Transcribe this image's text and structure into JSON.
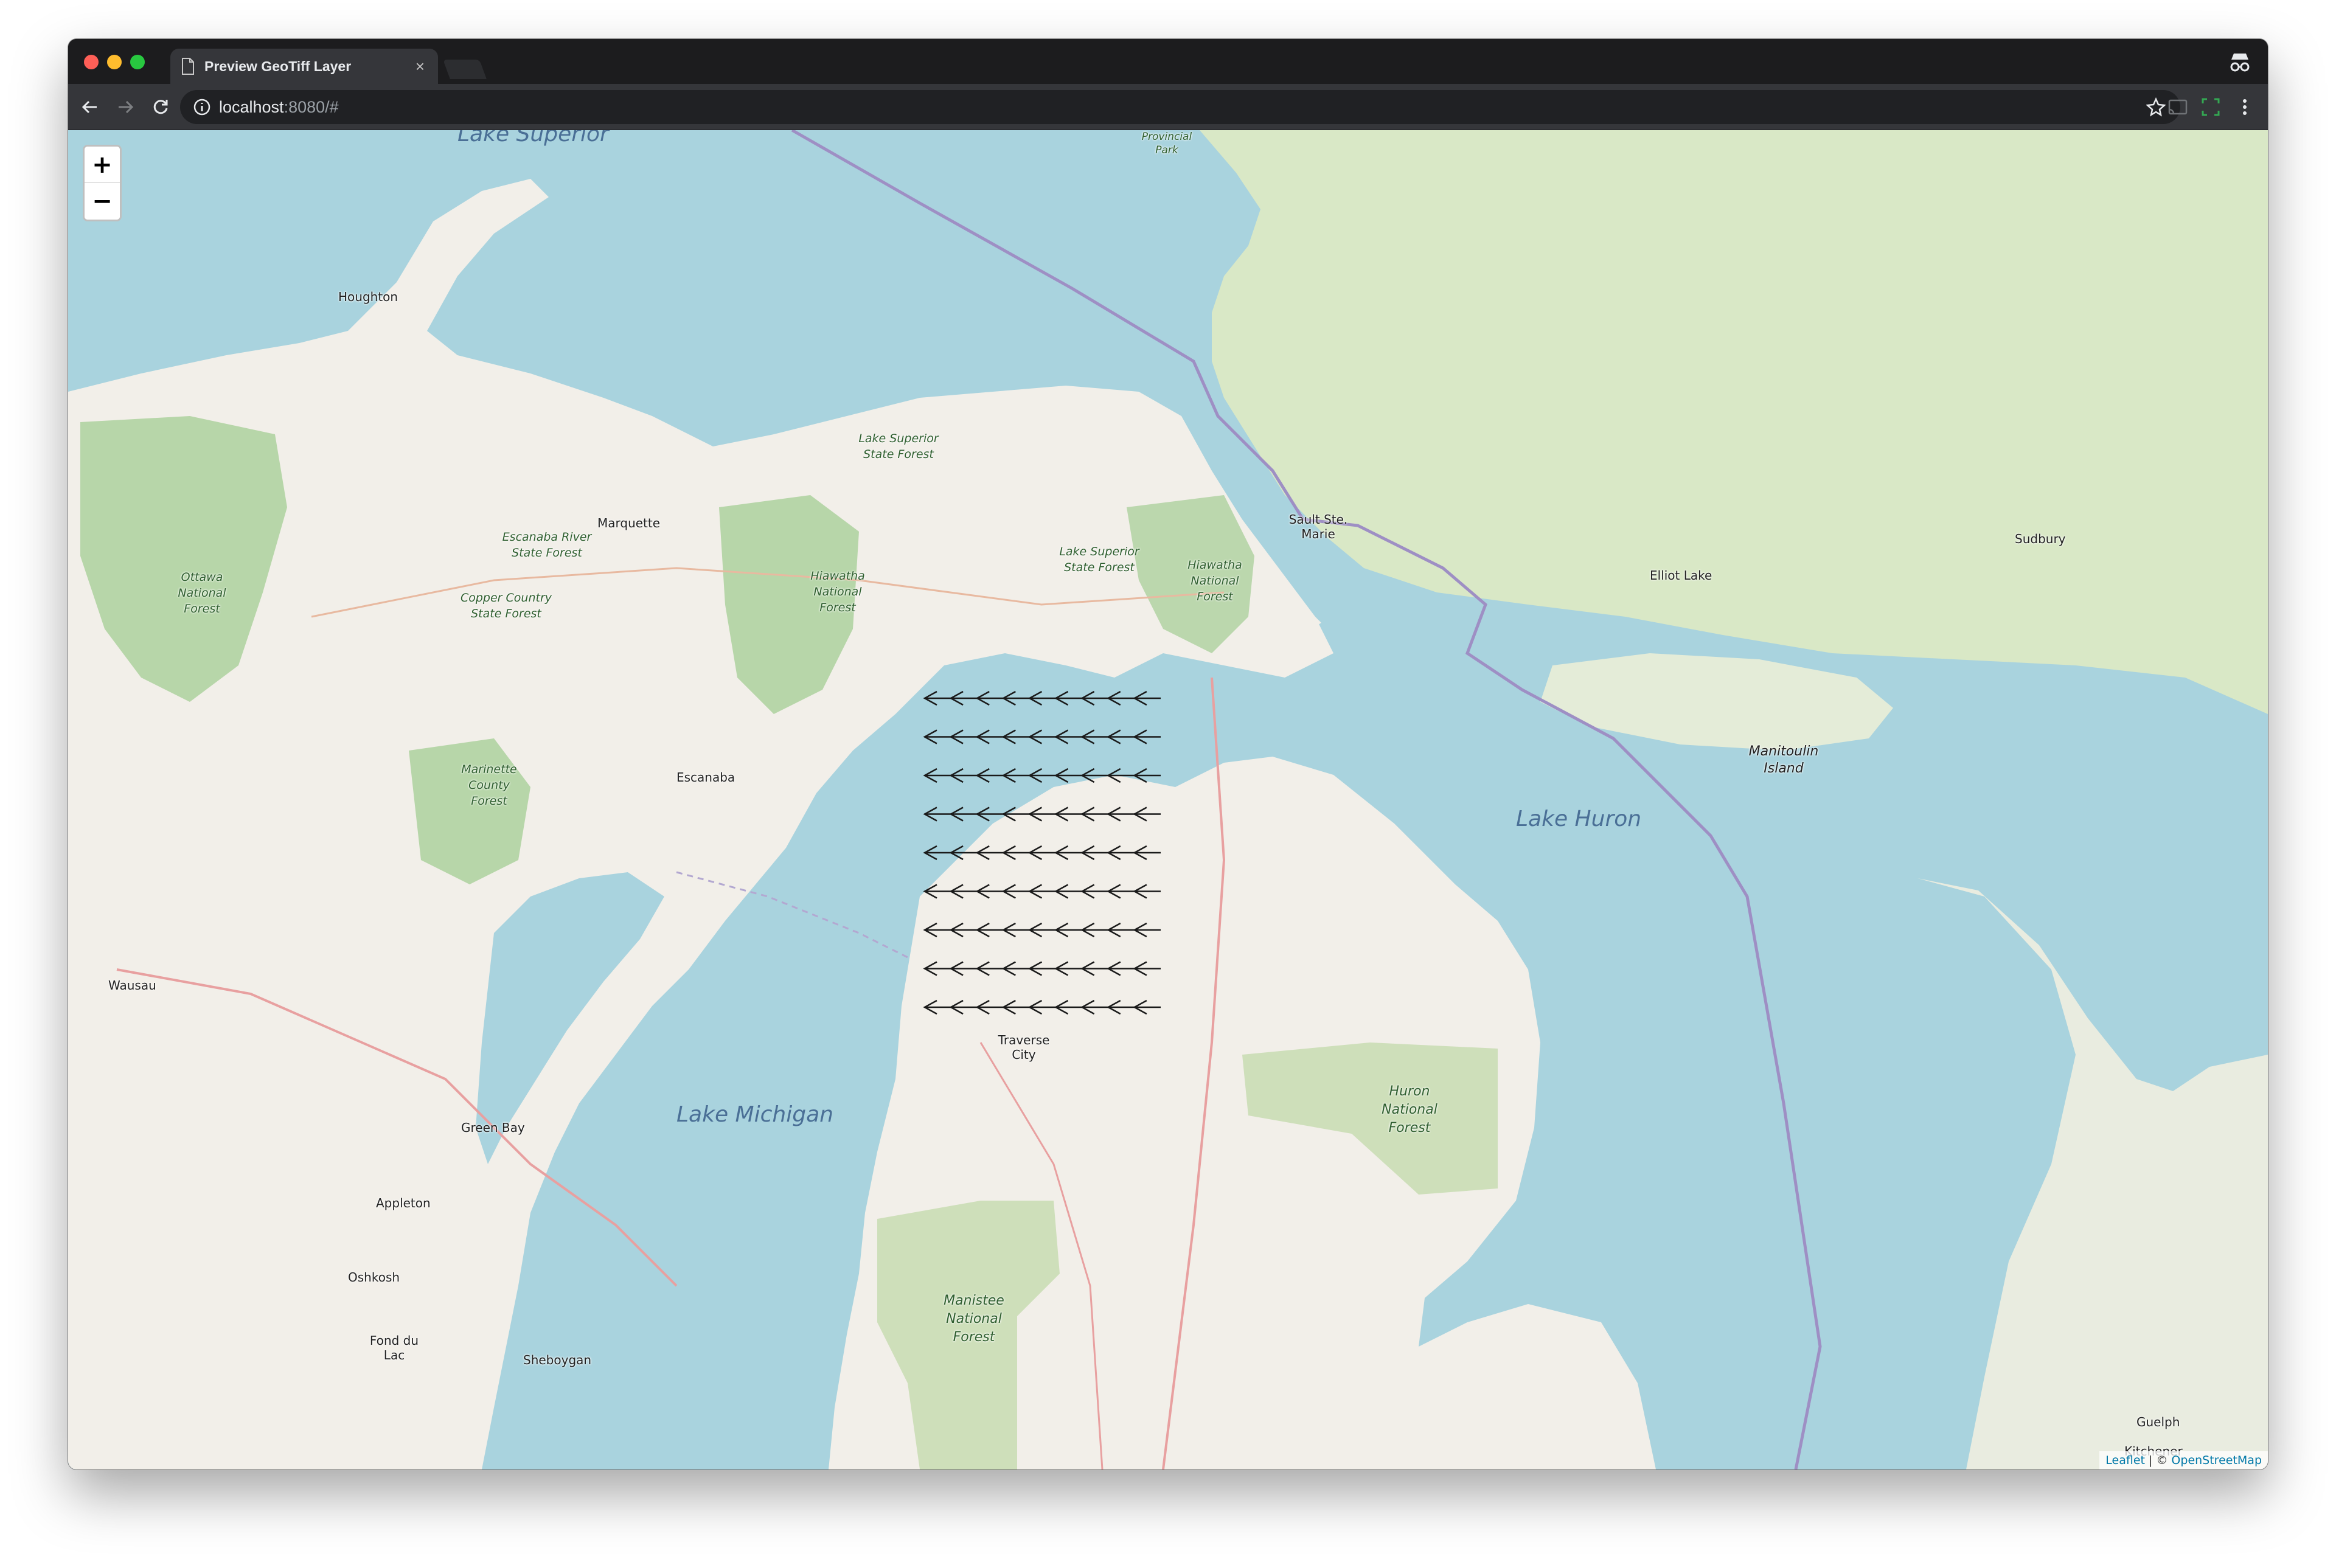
{
  "browser": {
    "tab_title": "Preview GeoTiff Layer",
    "tab_close": "×",
    "url_host": "localhost",
    "url_rest": ":8080/#"
  },
  "map": {
    "zoom_in": "+",
    "zoom_out": "−",
    "attribution": {
      "leaflet": "Leaflet",
      "separator": "| ©",
      "osm": "OpenStreetMap"
    },
    "labels": {
      "lake_superior": "Lake Superior",
      "lake_michigan": "Lake Michigan",
      "lake_huron": "Lake Huron",
      "houghton": "Houghton",
      "marquette": "Marquette",
      "escanaba": "Escanaba",
      "sault_ste_marie": "Sault Ste. Marie",
      "elliot_lake": "Elliot Lake",
      "sudbury": "Sudbury",
      "manitoulin_island": "Manitoulin Island",
      "wausau": "Wausau",
      "green_bay": "Green Bay",
      "appleton": "Appleton",
      "oshkosh": "Oshkosh",
      "fond_du_lac": "Fond du Lac",
      "sheboygan": "Sheboygan",
      "traverse_city": "Traverse City",
      "guelph": "Guelph",
      "kitchener": "Kitchener",
      "provincial_park": "Provincial Park",
      "ottawa_nf": "Ottawa National Forest",
      "escanaba_rsf": "Escanaba River State Forest",
      "copper_country_sf": "Copper Country State Forest",
      "lake_superior_sf_west": "Lake Superior State Forest",
      "lake_superior_sf_east": "Lake Superior State Forest",
      "hiawatha_nf_west": "Hiawatha National Forest",
      "hiawatha_nf_east": "Hiawatha National Forest",
      "marinette_cf": "Marinette County Forest",
      "huron_nf": "Huron National Forest",
      "manistee_nf": "Manistee National Forest"
    },
    "vector_field": {
      "rows": 9,
      "cols": 9,
      "direction": "west",
      "color": "#1a1a1a"
    }
  },
  "colors": {
    "water": "#a9d3de",
    "land": "#f2efe9",
    "forest": "#add19e",
    "boundary": "#9e8fc4"
  }
}
